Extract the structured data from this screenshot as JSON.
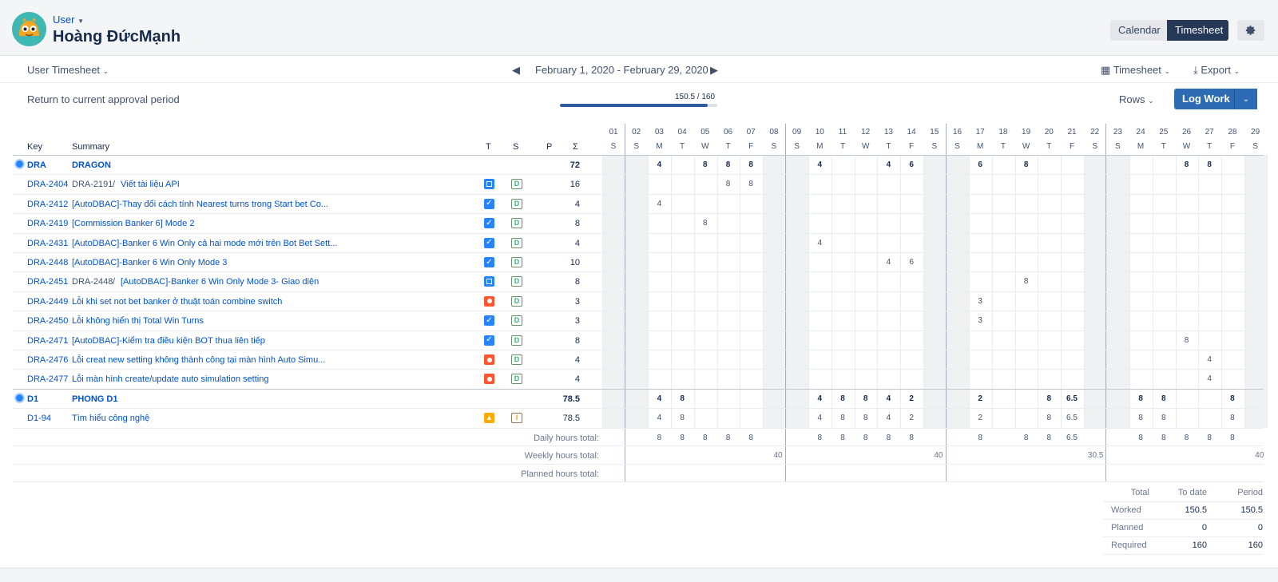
{
  "user": {
    "link": "User",
    "name": "Hoàng ĐứcMạnh"
  },
  "view_toggle": {
    "calendar": "Calendar",
    "timesheet": "Timesheet"
  },
  "toolbar": {
    "left": "User Timesheet",
    "period": "February 1, 2020 - February 29, 2020",
    "timesheet": "Timesheet",
    "export": "Export"
  },
  "approval": {
    "return_label": "Return to current approval period",
    "progress_text": "150.5 / 160",
    "progress_fraction": 0.9406,
    "rows_label": "Rows",
    "log_work": "Log Work"
  },
  "columns": {
    "key": "Key",
    "summary": "Summary",
    "type": "T",
    "status": "S",
    "planned": "P",
    "total": "Σ"
  },
  "days": [
    {
      "d": "01",
      "w": "S"
    },
    {
      "d": "02",
      "w": "S"
    },
    {
      "d": "03",
      "w": "M"
    },
    {
      "d": "04",
      "w": "T"
    },
    {
      "d": "05",
      "w": "W"
    },
    {
      "d": "06",
      "w": "T"
    },
    {
      "d": "07",
      "w": "F"
    },
    {
      "d": "08",
      "w": "S"
    },
    {
      "d": "09",
      "w": "S"
    },
    {
      "d": "10",
      "w": "M"
    },
    {
      "d": "11",
      "w": "T"
    },
    {
      "d": "12",
      "w": "W"
    },
    {
      "d": "13",
      "w": "T"
    },
    {
      "d": "14",
      "w": "F"
    },
    {
      "d": "15",
      "w": "S"
    },
    {
      "d": "16",
      "w": "S"
    },
    {
      "d": "17",
      "w": "M"
    },
    {
      "d": "18",
      "w": "T"
    },
    {
      "d": "19",
      "w": "W"
    },
    {
      "d": "20",
      "w": "T"
    },
    {
      "d": "21",
      "w": "F"
    },
    {
      "d": "22",
      "w": "S"
    },
    {
      "d": "23",
      "w": "S"
    },
    {
      "d": "24",
      "w": "M"
    },
    {
      "d": "25",
      "w": "T"
    },
    {
      "d": "26",
      "w": "W"
    },
    {
      "d": "27",
      "w": "T"
    },
    {
      "d": "28",
      "w": "F"
    },
    {
      "d": "29",
      "w": "S"
    }
  ],
  "rows": [
    {
      "kind": "group",
      "key": "DRA",
      "summary": "DRAGON",
      "total": "72",
      "days": {
        "3": "4",
        "5": "8",
        "6": "8",
        "7": "8",
        "10": "4",
        "13": "4",
        "14": "6",
        "17": "6",
        "19": "8",
        "26": "8",
        "27": "8"
      }
    },
    {
      "kind": "issue",
      "key": "DRA-2404",
      "parent": "DRA-2191",
      "summary": "Viết tài liệu API",
      "type": "subtask",
      "status": "D",
      "total": "16",
      "days": {
        "6": "8",
        "7": "8"
      }
    },
    {
      "kind": "issue",
      "key": "DRA-2412",
      "summary": "[AutoDBAC]-Thay đổi cách tính Nearest turns trong Start bet Co...",
      "type": "task",
      "status": "D",
      "total": "4",
      "days": {
        "3": "4"
      }
    },
    {
      "kind": "issue",
      "key": "DRA-2419",
      "summary": "[Commission Banker 6] Mode 2",
      "type": "task",
      "status": "D",
      "total": "8",
      "days": {
        "5": "8"
      }
    },
    {
      "kind": "issue",
      "key": "DRA-2431",
      "summary": "[AutoDBAC]-Banker 6 Win Only cả hai mode mới trên Bot Bet Sett...",
      "type": "task",
      "status": "D",
      "total": "4",
      "days": {
        "10": "4"
      }
    },
    {
      "kind": "issue",
      "key": "DRA-2448",
      "summary": "[AutoDBAC]-Banker 6 Win Only Mode 3",
      "type": "task",
      "status": "D",
      "total": "10",
      "days": {
        "13": "4",
        "14": "6"
      }
    },
    {
      "kind": "issue",
      "key": "DRA-2451",
      "parent": "DRA-2448",
      "summary": "[AutoDBAC]-Banker 6 Win Only Mode 3- Giao diện",
      "type": "subtask",
      "status": "D",
      "total": "8",
      "days": {
        "19": "8"
      }
    },
    {
      "kind": "issue",
      "key": "DRA-2449",
      "summary": "Lỗi khi set not bet banker ở thuật toán combine switch",
      "type": "bug",
      "status": "D",
      "total": "3",
      "days": {
        "17": "3"
      }
    },
    {
      "kind": "issue",
      "key": "DRA-2450",
      "summary": "Lỗi không hiển thị Total Win Turns",
      "type": "task",
      "status": "D",
      "total": "3",
      "days": {
        "17": "3"
      }
    },
    {
      "kind": "issue",
      "key": "DRA-2471",
      "summary": "[AutoDBAC]-Kiểm tra điều kiện BOT thua liên tiếp",
      "type": "task",
      "status": "D",
      "total": "8",
      "days": {
        "26": "8"
      }
    },
    {
      "kind": "issue",
      "key": "DRA-2476",
      "summary": "Lỗi creat new setting không thành công tại màn hình Auto Simu...",
      "type": "bug",
      "status": "D",
      "total": "4",
      "days": {
        "27": "4"
      }
    },
    {
      "kind": "issue",
      "key": "DRA-2477",
      "summary": "Lỗi màn hình create/update auto simulation setting",
      "type": "bug",
      "status": "D",
      "total": "4",
      "days": {
        "27": "4"
      }
    },
    {
      "kind": "group",
      "key": "D1",
      "summary": "PHONG D1",
      "total": "78.5",
      "days": {
        "3": "4",
        "4": "8",
        "10": "4",
        "11": "8",
        "12": "8",
        "13": "4",
        "14": "2",
        "17": "2",
        "20": "8",
        "21": "6.5",
        "24": "8",
        "25": "8",
        "28": "8"
      }
    },
    {
      "kind": "issue",
      "key": "D1-94",
      "summary": "Tìm hiểu công nghệ",
      "type": "improvement",
      "status": "I",
      "total": "78.5",
      "days": {
        "3": "4",
        "4": "8",
        "10": "4",
        "11": "8",
        "12": "8",
        "13": "4",
        "14": "2",
        "17": "2",
        "20": "8",
        "21": "6.5",
        "24": "8",
        "25": "8",
        "28": "8"
      }
    }
  ],
  "daily_totals": {
    "label": "Daily hours total:",
    "days": {
      "3": "8",
      "4": "8",
      "5": "8",
      "6": "8",
      "7": "8",
      "10": "8",
      "11": "8",
      "12": "8",
      "13": "8",
      "14": "8",
      "17": "8",
      "19": "8",
      "20": "8",
      "21": "6.5",
      "24": "8",
      "25": "8",
      "26": "8",
      "27": "8",
      "28": "8"
    }
  },
  "weekly_totals": {
    "label": "Weekly hours total:",
    "weeks": [
      "40",
      "40",
      "30.5",
      "40"
    ]
  },
  "planned_totals": {
    "label": "Planned hours total:"
  },
  "summary_table": {
    "headers": [
      "Total",
      "To date",
      "Period"
    ],
    "rows": [
      {
        "label": "Worked",
        "to_date": "150.5",
        "period": "150.5"
      },
      {
        "label": "Planned",
        "to_date": "0",
        "period": "0"
      },
      {
        "label": "Required",
        "to_date": "160",
        "period": "160"
      }
    ]
  },
  "colors": {
    "link": "#0052cc",
    "accent": "#2d6cb5",
    "dark": "#253858",
    "task": "#2684ff",
    "bug": "#ff5630",
    "improve": "#ffab00",
    "done": "#36b37e"
  }
}
